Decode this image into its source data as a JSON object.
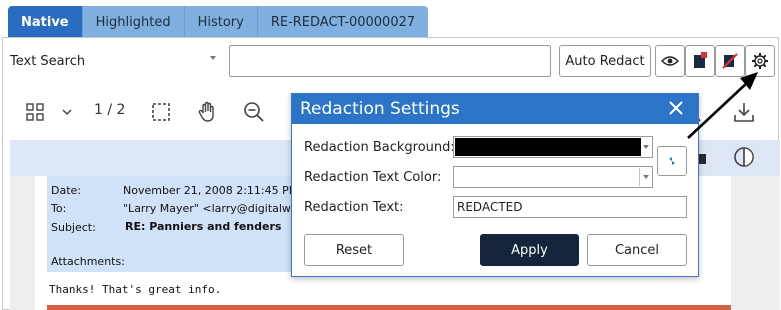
{
  "tabs": [
    {
      "label": "Native",
      "active": true
    },
    {
      "label": "Highlighted",
      "active": false
    },
    {
      "label": "History",
      "active": false
    },
    {
      "label": "RE-REDACT-00000027",
      "active": false
    }
  ],
  "search": {
    "mode": "Text Search",
    "value": "",
    "auto_redact_label": "Auto Redact"
  },
  "toolbar": {
    "page_indicator": "1 / 2",
    "icons": [
      "grid-icon",
      "chevron-down-icon",
      "selection-icon",
      "hand-icon",
      "zoom-out-icon",
      "search-icon",
      "download-icon",
      "contrast-icon",
      "eye-icon",
      "redact-note-icon",
      "erase-redaction-icon",
      "gear-icon"
    ]
  },
  "email": {
    "date_label": "Date:",
    "date_value": "November 21, 2008 2:11:45 PM (-",
    "to_label": "To:",
    "to_value": "\"Larry Mayer\" <larry@digitalwarro",
    "subject_label": "Subject:",
    "subject_value": "RE: Panniers and fenders",
    "attachments_label": "Attachments:",
    "body_line": "Thanks!  That's great info."
  },
  "dialog": {
    "title": "Redaction Settings",
    "background_label": "Redaction Background:",
    "background_color": "#000000",
    "text_color_label": "Redaction Text Color:",
    "text_color_value": "",
    "text_label": "Redaction Text:",
    "text_value": "REDACTED",
    "reset_label": "Reset",
    "apply_label": "Apply",
    "cancel_label": "Cancel"
  },
  "colors": {
    "tab_active": "#2a6cc2",
    "tab_inactive": "#7fb0e0",
    "dialog_header": "#2b74c7",
    "apply_button": "#15243a",
    "email_highlight": "#cfe2f7"
  }
}
